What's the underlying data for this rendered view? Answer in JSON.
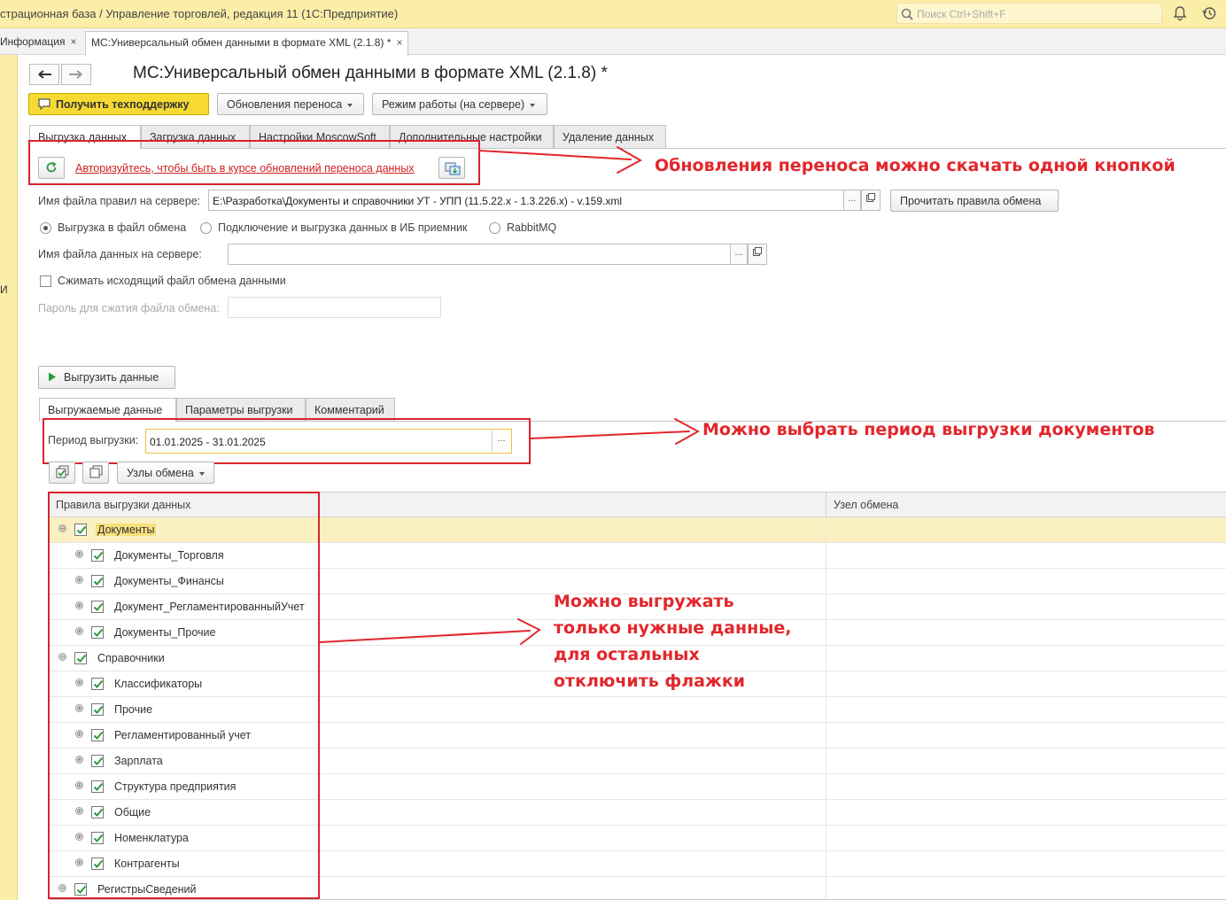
{
  "titlebar": {
    "title": "страционная база / Управление торговлей, редакция 11  (1С:Предприятие)",
    "search_placeholder": "Поиск Ctrl+Shift+F"
  },
  "window_tabs": [
    {
      "label": "Информация",
      "close": "×"
    },
    {
      "label": "МС:Универсальный обмен данными в формате XML (2.1.8) *",
      "close": "×"
    }
  ],
  "left_strip_text": "И",
  "form": {
    "title": "МС:Универсальный обмен данными в формате XML (2.1.8) *",
    "toolbar": {
      "support": "Получить техподдержку",
      "updates": "Обновления переноса",
      "mode": "Режим работы (на сервере)"
    },
    "tabs": [
      "Выгрузка данных",
      "Загрузка данных",
      "Настройки MoscowSoft",
      "Дополнительные настройки",
      "Удаление данных"
    ],
    "auth_link": "Авторизуйтесь, чтобы быть в курсе обновлений переноса данных",
    "rules_file_label": "Имя файла правил на сервере:",
    "rules_file_value": "E:\\Разработка\\Документы и справочники УТ - УПП (11.5.22.x - 1.3.226.x) - v.159.xml",
    "read_rules_button": "Прочитать правила обмена",
    "radio_options": [
      "Выгрузка в файл обмена",
      "Подключение и выгрузка данных в ИБ приемник",
      "RabbitMQ"
    ],
    "data_file_label": "Имя файла данных на сервере:",
    "data_file_value": "",
    "compress_label": "Сжимать исходящий файл обмена данными",
    "password_label": "Пароль для сжатия файла обмена:",
    "export_button": "Выгрузить данные",
    "subtabs": [
      "Выгружаемые данные",
      "Параметры выгрузки",
      "Комментарий"
    ],
    "period_label": "Период выгрузки:",
    "period_value": "01.01.2025 - 31.01.2025",
    "nodes_button": "Узлы обмена",
    "ellipsis": "..."
  },
  "table": {
    "columns": [
      "Правила выгрузки данных",
      "Узел обмена"
    ],
    "rows": [
      {
        "label": "Документы",
        "level": 0,
        "expand": "⊖",
        "selected": true
      },
      {
        "label": "Документы_Торговля",
        "level": 1,
        "expand": "⊕"
      },
      {
        "label": "Документы_Финансы",
        "level": 1,
        "expand": "⊕"
      },
      {
        "label": "Документ_РегламентированныйУчет",
        "level": 1,
        "expand": "⊕"
      },
      {
        "label": "Документы_Прочие",
        "level": 1,
        "expand": "⊕"
      },
      {
        "label": "Справочники",
        "level": 0,
        "expand": "⊖"
      },
      {
        "label": "Классификаторы",
        "level": 1,
        "expand": "⊕"
      },
      {
        "label": "Прочие",
        "level": 1,
        "expand": "⊕"
      },
      {
        "label": "Регламентированный учет",
        "level": 1,
        "expand": "⊕"
      },
      {
        "label": "Зарплата",
        "level": 1,
        "expand": "⊕"
      },
      {
        "label": "Структура предприятия",
        "level": 1,
        "expand": "⊕"
      },
      {
        "label": "Общие",
        "level": 1,
        "expand": "⊕"
      },
      {
        "label": "Номенклатура",
        "level": 1,
        "expand": "⊕"
      },
      {
        "label": "Контрагенты",
        "level": 1,
        "expand": "⊕"
      },
      {
        "label": "РегистрыСведений",
        "level": 0,
        "expand": "⊖"
      }
    ]
  },
  "annotations": {
    "a1": "Обновления переноса можно скачать одной кнопкой",
    "a2": "Можно выбрать период выгрузки документов",
    "a3_lines": [
      "Можно выгружать",
      "только нужные данные,",
      "для остальных",
      "отключить флажки"
    ]
  },
  "colors": {
    "annotation": "#e3262b",
    "titlebar": "#fbeea8",
    "support_button": "#f7d934",
    "selected_row": "#fbf0c1"
  }
}
